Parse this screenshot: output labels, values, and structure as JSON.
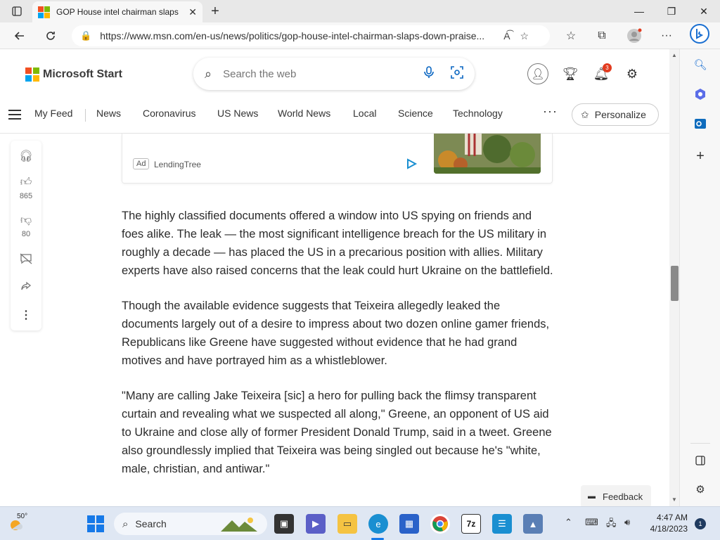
{
  "browser": {
    "tab_title": "GOP House intel chairman slaps",
    "tab_close": "✕",
    "new_tab": "+",
    "url": "https://www.msn.com/en-us/news/politics/gop-house-intel-chairman-slaps-down-praise...",
    "window_controls": {
      "minimize": "—",
      "restore": "❐",
      "close": "✕"
    }
  },
  "msn": {
    "brand": "Microsoft Start",
    "search_placeholder": "Search the web",
    "notifications_count": "3",
    "nav": [
      "My Feed",
      "News",
      "Coronavirus",
      "US News",
      "World News",
      "Local",
      "Science",
      "Technology"
    ],
    "nav_more": "···",
    "personalize": "Personalize"
  },
  "rail": {
    "like_count": "865",
    "dislike_count": "80"
  },
  "ad": {
    "badge": "Ad",
    "source": "LendingTree"
  },
  "article": {
    "paragraphs": [
      "The highly classified documents offered a window into US spying on friends and foes alike. The leak — the most significant intelligence breach for the US military in roughly a decade — has placed the US in a precarious position with allies. Military experts have also raised concerns that the leak could hurt Ukraine on the battlefield.",
      "Though the available evidence suggests that Teixeira allegedly leaked the documents largely out of a desire to impress about two dozen online gamer friends, Republicans like Greene have suggested without evidence that he had grand motives and have portrayed him as a whistleblower.",
      "\"Many are calling Jake Teixeira [sic] a hero for pulling back the flimsy transparent curtain and revealing what we suspected all along,\" Greene, an opponent of US aid to Ukraine and close ally of former President Donald Trump, said in a tweet. Greene also groundlessly implied that Teixeira was being singled out because he's \"white, male, christian, and antiwar.\""
    ]
  },
  "feedback": "Feedback",
  "taskbar": {
    "weather_temp": "50°",
    "search_label": "Search",
    "time": "4:47 AM",
    "date": "4/18/2023",
    "notification_count": "1"
  },
  "colors": {
    "accent": "#0a66c2",
    "taskbar_bg": "#dfe7f3",
    "ms_red": "#f25022",
    "ms_green": "#7fba00",
    "ms_blue": "#00a4ef",
    "ms_yellow": "#ffb900"
  }
}
